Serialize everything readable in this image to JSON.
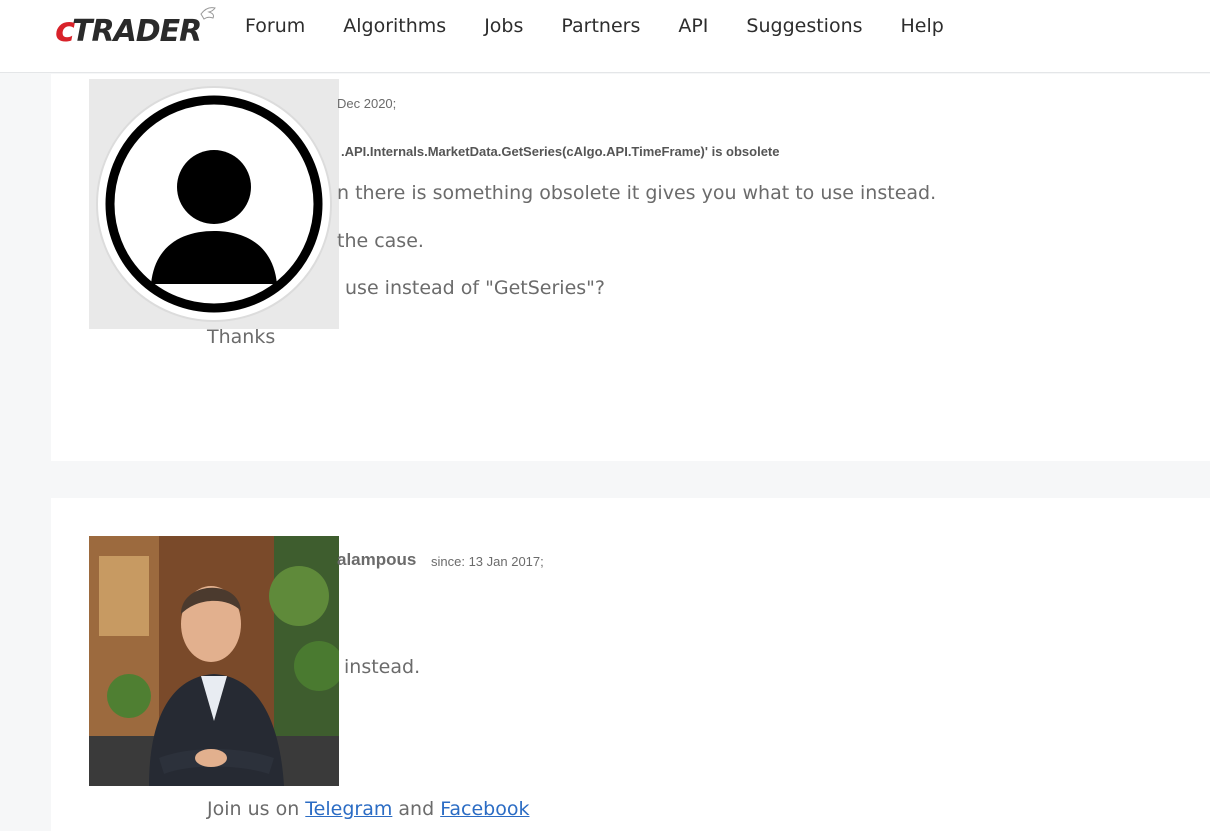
{
  "header": {
    "logo_text": "cTRADER",
    "nav": [
      "Forum",
      "Algorithms",
      "Jobs",
      "Partners",
      "API",
      "Suggestions",
      "Help"
    ]
  },
  "posts": [
    {
      "avatar": "default-user-icon",
      "date_fragment": "Dec 2020;",
      "code_fragment": ".API.Internals.MarketData.GetSeries(cAlgo.API.TimeFrame)' is obsolete",
      "lines": [
        "n there is something obsolete it gives you what to use instead.",
        "the case.",
        "use instead of \"GetSeries\"?",
        "Thanks"
      ]
    },
    {
      "avatar": "author-photo",
      "author_fragment": "alampous",
      "since": "since: 13 Jan 2017;",
      "lines": [
        "instead."
      ],
      "footer": {
        "prefix": "Join us on",
        "link1": "Telegram",
        "middle": "and",
        "link2": "Facebook"
      }
    }
  ],
  "colors": {
    "background": "#f6f7f8",
    "card": "#ffffff",
    "link": "#2b6cc4",
    "logo_red": "#d8222a"
  }
}
